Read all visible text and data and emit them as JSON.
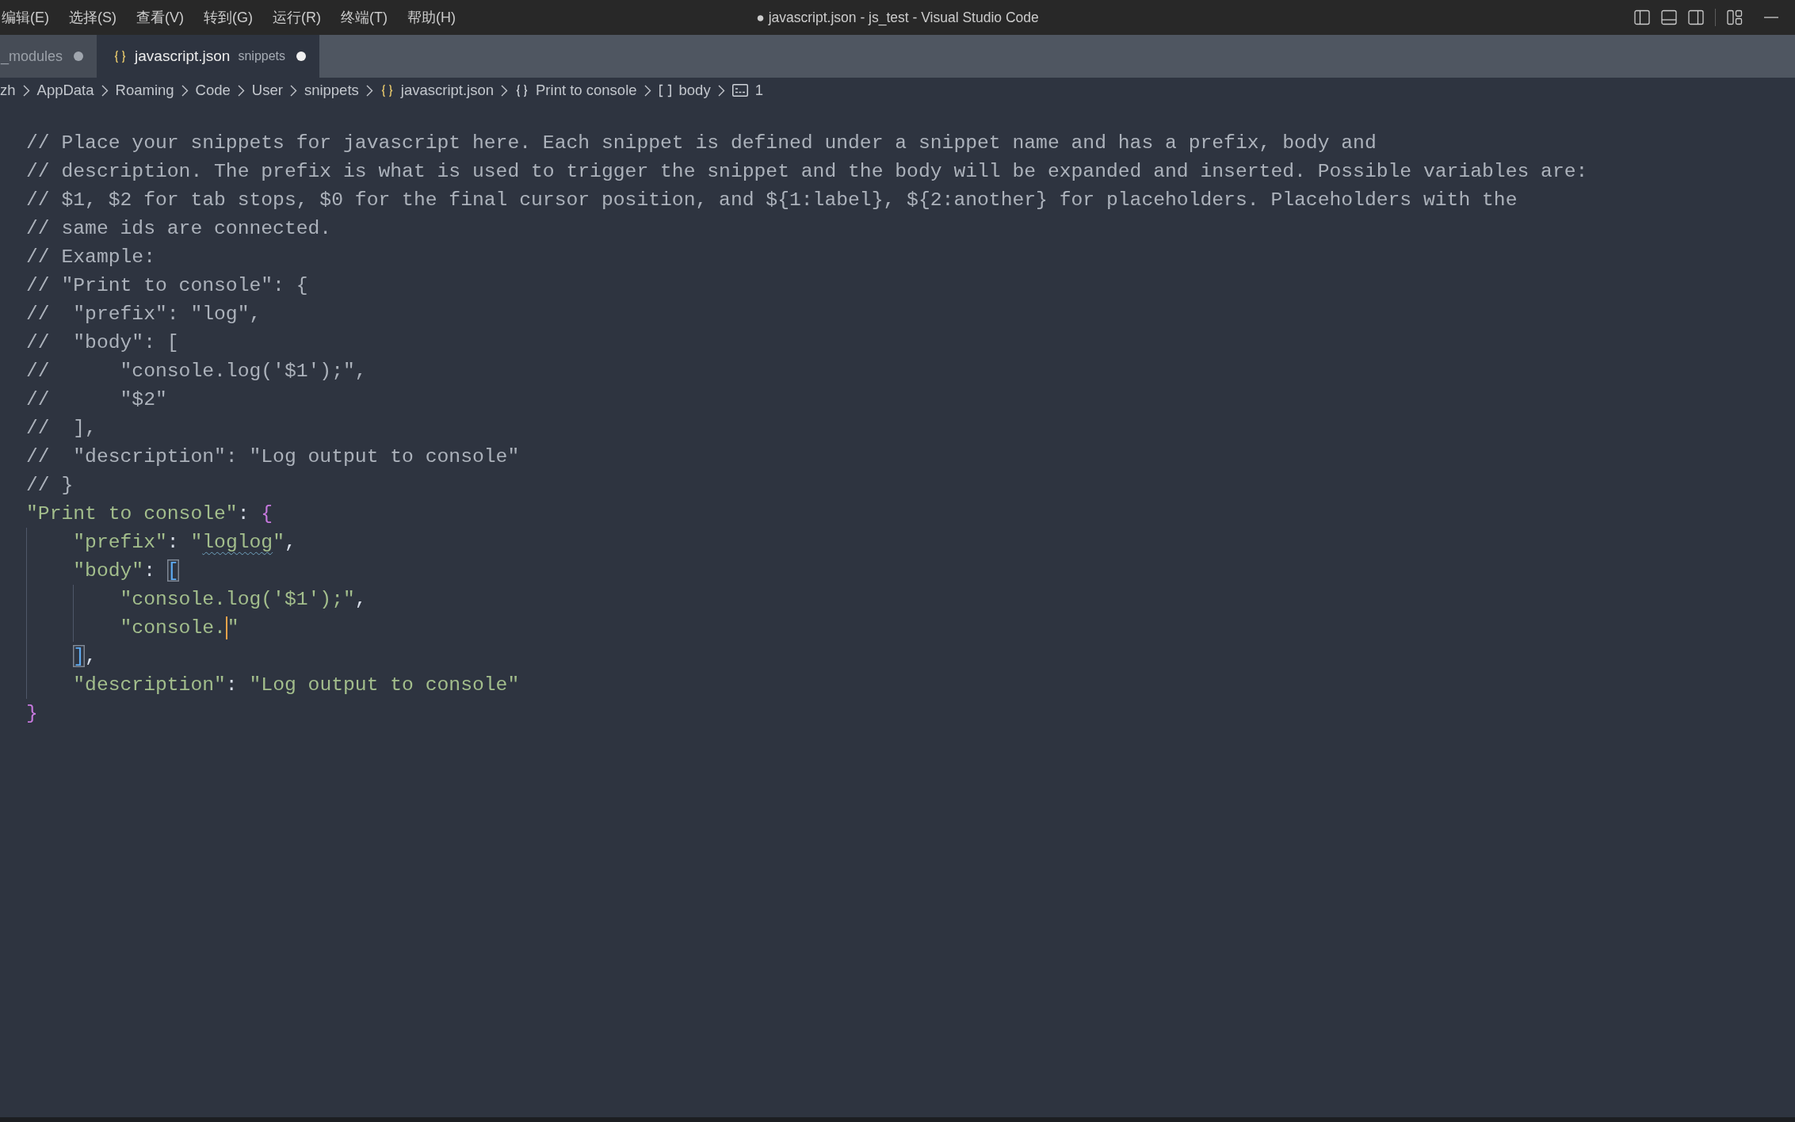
{
  "menu": [
    "编辑(E)",
    "选择(S)",
    "查看(V)",
    "转到(G)",
    "运行(R)",
    "终端(T)",
    "帮助(H)"
  ],
  "window": {
    "title": "● javascript.json - js_test - Visual Studio Code"
  },
  "tabs": [
    {
      "kind": "plain",
      "label": "_modules",
      "selected": false,
      "dirty": true
    },
    {
      "kind": "file",
      "label": "javascript.json",
      "detail": "snippets",
      "selected": true,
      "dirty": true
    }
  ],
  "breadcrumbs": [
    {
      "kind": "folder",
      "label": "zh"
    },
    {
      "kind": "folder",
      "label": "AppData"
    },
    {
      "kind": "folder",
      "label": "Roaming"
    },
    {
      "kind": "folder",
      "label": "Code"
    },
    {
      "kind": "folder",
      "label": "User"
    },
    {
      "kind": "folder",
      "label": "snippets"
    },
    {
      "kind": "file",
      "label": "javascript.json"
    },
    {
      "kind": "object",
      "label": "Print to console"
    },
    {
      "kind": "array",
      "label": "body"
    },
    {
      "kind": "string",
      "label": "1"
    }
  ],
  "editor": {
    "lines": [
      {
        "tokens": [
          {
            "kind": "comment",
            "text": "// Place your snippets for javascript here. Each snippet is defined under a snippet name and has a prefix, body and"
          }
        ]
      },
      {
        "tokens": [
          {
            "kind": "comment",
            "text": "// description. The prefix is what is used to trigger the snippet and the body will be expanded and inserted. Possible variables are:"
          }
        ]
      },
      {
        "tokens": [
          {
            "kind": "comment",
            "text": "// $1, $2 for tab stops, $0 for the final cursor position, and ${1:label}, ${2:another} for placeholders. Placeholders with the"
          }
        ]
      },
      {
        "tokens": [
          {
            "kind": "comment",
            "text": "// same ids are connected."
          }
        ]
      },
      {
        "tokens": [
          {
            "kind": "comment",
            "text": "// Example:"
          }
        ]
      },
      {
        "tokens": [
          {
            "kind": "comment",
            "text": "// \"Print to console\": {"
          }
        ]
      },
      {
        "tokens": [
          {
            "kind": "comment",
            "text": "//  \"prefix\": \"log\","
          }
        ]
      },
      {
        "tokens": [
          {
            "kind": "comment",
            "text": "//  \"body\": ["
          }
        ]
      },
      {
        "tokens": [
          {
            "kind": "comment",
            "text": "//      \"console.log('$1');\","
          }
        ]
      },
      {
        "tokens": [
          {
            "kind": "comment",
            "text": "//      \"$2\""
          }
        ]
      },
      {
        "tokens": [
          {
            "kind": "comment",
            "text": "//  ],"
          }
        ]
      },
      {
        "tokens": [
          {
            "kind": "comment",
            "text": "//  \"description\": \"Log output to console\""
          }
        ]
      },
      {
        "tokens": [
          {
            "kind": "comment",
            "text": "// }"
          }
        ]
      },
      {
        "tokens": [
          {
            "kind": "string",
            "text": "\"Print to console\""
          },
          {
            "kind": "punct",
            "text": ": "
          },
          {
            "kind": "brace",
            "text": "{"
          }
        ]
      },
      {
        "tokens": [
          {
            "kind": "indent"
          },
          {
            "kind": "string",
            "text": "\"prefix\""
          },
          {
            "kind": "punct",
            "text": ": "
          },
          {
            "kind": "string",
            "text": "\""
          },
          {
            "kind": "misspelled",
            "text": "loglog"
          },
          {
            "kind": "string",
            "text": "\""
          },
          {
            "kind": "punct",
            "text": ","
          }
        ]
      },
      {
        "tokens": [
          {
            "kind": "indent"
          },
          {
            "kind": "string",
            "text": "\"body\""
          },
          {
            "kind": "punct",
            "text": ": "
          },
          {
            "kind": "bracket-match",
            "text": "["
          }
        ]
      },
      {
        "tokens": [
          {
            "kind": "indent"
          },
          {
            "kind": "indent"
          },
          {
            "kind": "string",
            "text": "\"console.log('$1');\""
          },
          {
            "kind": "punct",
            "text": ","
          }
        ]
      },
      {
        "tokens": [
          {
            "kind": "indent"
          },
          {
            "kind": "indent"
          },
          {
            "kind": "string",
            "text": "\"console."
          },
          {
            "kind": "caret"
          },
          {
            "kind": "string",
            "text": "\""
          }
        ]
      },
      {
        "tokens": [
          {
            "kind": "indent"
          },
          {
            "kind": "bracket-match",
            "text": "]"
          },
          {
            "kind": "punct",
            "text": ","
          }
        ]
      },
      {
        "tokens": [
          {
            "kind": "indent"
          },
          {
            "kind": "string",
            "text": "\"description\""
          },
          {
            "kind": "punct",
            "text": ": "
          },
          {
            "kind": "string",
            "text": "\"Log output to console\""
          }
        ]
      },
      {
        "tokens": [
          {
            "kind": "brace",
            "text": "}"
          }
        ]
      }
    ]
  }
}
